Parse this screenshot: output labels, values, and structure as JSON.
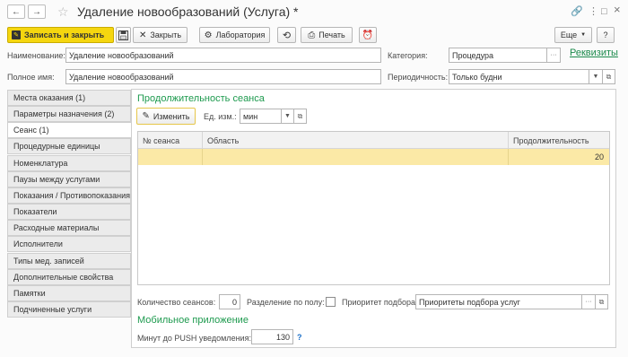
{
  "window": {
    "title": "Удаление новообразований (Услуга) *",
    "back_icon": "←",
    "forward_icon": "→",
    "star_icon": "☆",
    "link_icon": "🔗",
    "menu_icon": "⋮",
    "restore_icon": "□",
    "close_icon": "×"
  },
  "toolbar": {
    "save_close": "Записать и закрыть",
    "close": "Закрыть",
    "laboratory": "Лаборатория",
    "print": "Печать",
    "more": "Еще",
    "help": "?"
  },
  "fields": {
    "name_label": "Наименование:",
    "name_value": "Удаление новообразований",
    "fullname_label": "Полное имя:",
    "fullname_value": "Удаление новообразований",
    "category_label": "Категория:",
    "category_value": "Процедура",
    "periodicity_label": "Периодичность:",
    "periodicity_value": "Только будни",
    "requisites_link": "Реквизиты"
  },
  "sidebar": {
    "items": [
      {
        "label": "Места оказания (1)"
      },
      {
        "label": "Параметры назначения (2)"
      },
      {
        "label": "Сеанс (1)"
      },
      {
        "label": "Процедурные единицы"
      },
      {
        "label": "Номенклатура"
      },
      {
        "label": "Паузы между услугами"
      },
      {
        "label": "Показания / Противопоказания"
      },
      {
        "label": "Показатели"
      },
      {
        "label": "Расходные материалы"
      },
      {
        "label": "Исполнители"
      },
      {
        "label": "Типы мед. записей"
      },
      {
        "label": "Дополнительные свойства"
      },
      {
        "label": "Памятки"
      },
      {
        "label": "Подчиненные услуги"
      }
    ],
    "active_index": 2
  },
  "session": {
    "section_title": "Продолжительность сеанса",
    "edit_button": "Изменить",
    "unit_label": "Ед. изм.:",
    "unit_value": "мин",
    "table": {
      "columns": [
        "№ сеанса",
        "Область",
        "Продолжительность"
      ],
      "rows": [
        {
          "number": "",
          "area": "",
          "duration": "20"
        }
      ]
    },
    "count_label": "Количество сеансов:",
    "count_value": "0",
    "gender_label": "Разделение по полу:",
    "gender_checked": false,
    "priority_label": "Приоритет подбора:",
    "priority_value": "Приоритеты подбора услуг"
  },
  "mobile": {
    "section_title": "Мобильное приложение",
    "push_label": "Минут до PUSH уведомления:",
    "push_value": "130",
    "help": "?"
  },
  "colors": {
    "accent_green": "#1d9a4e",
    "primary_yellow": "#f5d60f",
    "selected_row": "#fbe9a6"
  }
}
